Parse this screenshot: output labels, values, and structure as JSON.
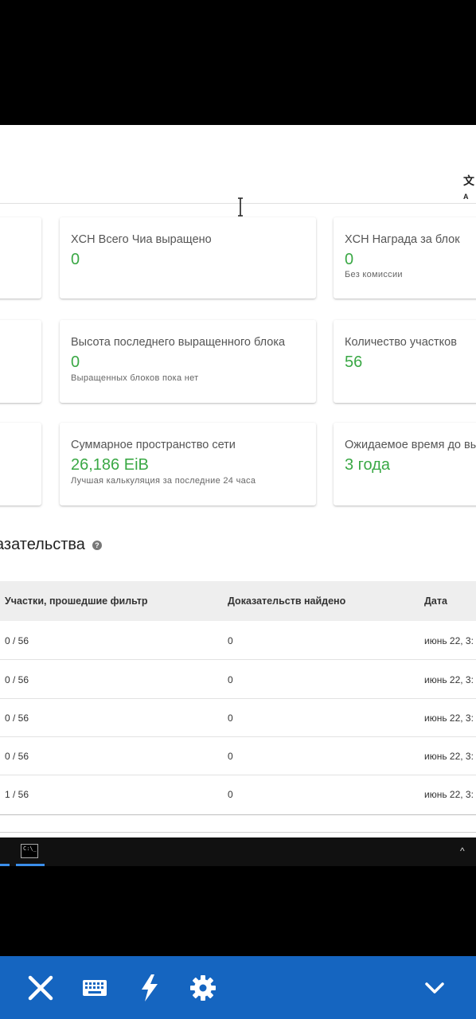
{
  "header": {
    "translate_icon": "translate-icon"
  },
  "cards": [
    {
      "label": "XCH Всего Чиа выращено",
      "value": "0",
      "sub": ""
    },
    {
      "label": "XCH Награда за блок",
      "value": "0",
      "sub": "Без комиссии"
    },
    {
      "label": "Высота последнего выращенного блока",
      "value": "0",
      "sub": "Выращенных блоков пока нет"
    },
    {
      "label": "Количество участков",
      "value": "56",
      "sub": ""
    },
    {
      "label": "Суммарное пространство сети",
      "value": "26,186 EiB",
      "sub": "Лучшая калькуляция за последние 24 часа"
    },
    {
      "label": "Ожидаемое время до вы",
      "value": "3 года",
      "sub": ""
    }
  ],
  "section": {
    "title": "азательства",
    "help_icon": "?"
  },
  "table": {
    "headers": [
      "Участки, прошедшие фильтр",
      "Доказательств найдено",
      "Дата"
    ],
    "rows": [
      [
        "0 / 56",
        "0",
        "июнь 22, 3:"
      ],
      [
        "0 / 56",
        "0",
        "июнь 22, 3:"
      ],
      [
        "0 / 56",
        "0",
        "июнь 22, 3:"
      ],
      [
        "0 / 56",
        "0",
        "июнь 22, 3:"
      ],
      [
        "1 / 56",
        "0",
        "июнь 22, 3:"
      ]
    ]
  },
  "taskbar": {
    "terminal_glyph": "C:\\_"
  },
  "colors": {
    "accent_green": "#3aa845",
    "bottom_bar": "#1565c0"
  },
  "bottom_bar": {
    "icons": [
      "close-icon",
      "keyboard-icon",
      "lightning-icon",
      "gear-icon",
      "chevron-down-icon"
    ]
  }
}
